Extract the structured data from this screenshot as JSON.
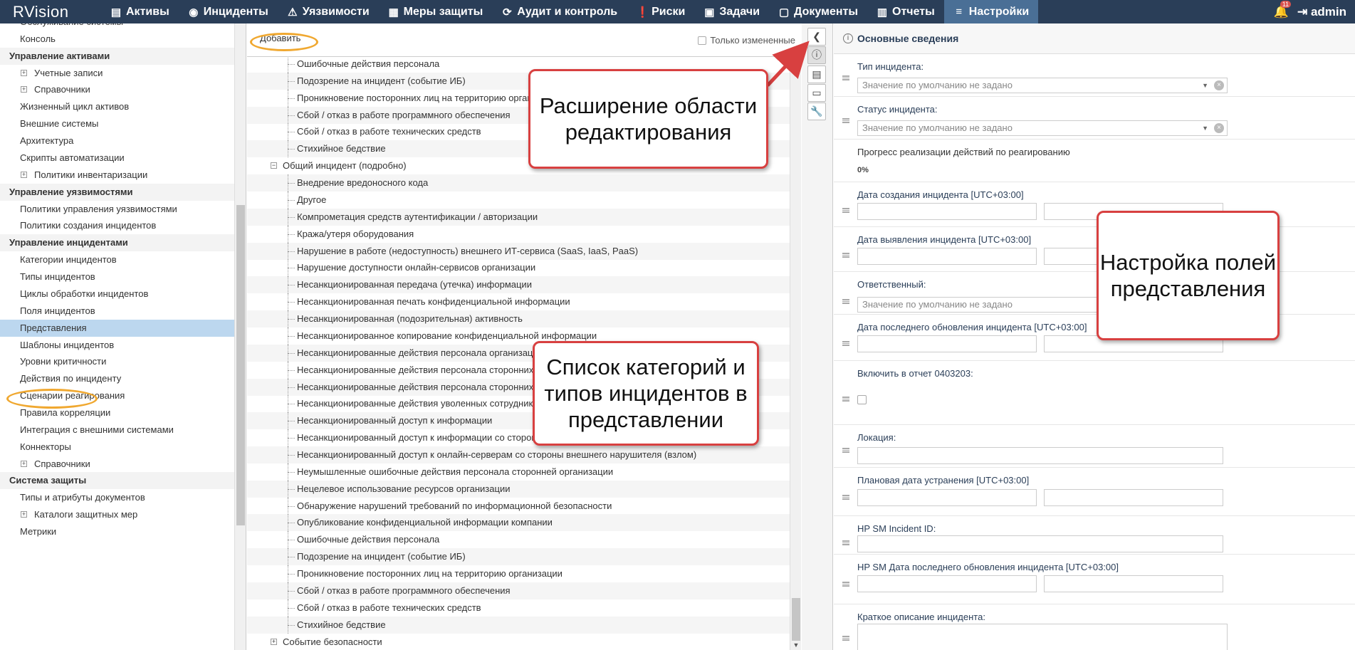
{
  "app": {
    "logo": "RVision"
  },
  "nav": [
    {
      "label": "Активы",
      "icon": "database-icon",
      "glyph": "▤"
    },
    {
      "label": "Инциденты",
      "icon": "target-icon",
      "glyph": "◉"
    },
    {
      "label": "Уязвимости",
      "icon": "warning-icon",
      "glyph": "⚠"
    },
    {
      "label": "Меры защиты",
      "icon": "shield-icon",
      "glyph": "▦"
    },
    {
      "label": "Аудит и контроль",
      "icon": "refresh-icon",
      "glyph": "⟳"
    },
    {
      "label": "Риски",
      "icon": "alert-circle-icon",
      "glyph": "❗"
    },
    {
      "label": "Задачи",
      "icon": "tasks-icon",
      "glyph": "▣"
    },
    {
      "label": "Документы",
      "icon": "document-icon",
      "glyph": "▢"
    },
    {
      "label": "Отчеты",
      "icon": "report-icon",
      "glyph": "▥"
    },
    {
      "label": "Настройки",
      "icon": "menu-icon",
      "glyph": "≡"
    }
  ],
  "top_right": {
    "notifications": "11",
    "user": "admin"
  },
  "sidebar": {
    "rows": [
      {
        "type": "item",
        "label": "Обслуживание системы"
      },
      {
        "type": "item",
        "label": "Консоль"
      },
      {
        "type": "group",
        "label": "Управление активами"
      },
      {
        "type": "sub",
        "label": "Учетные записи"
      },
      {
        "type": "sub",
        "label": "Справочники"
      },
      {
        "type": "item",
        "label": "Жизненный цикл активов"
      },
      {
        "type": "item",
        "label": "Внешние системы"
      },
      {
        "type": "item",
        "label": "Архитектура"
      },
      {
        "type": "item",
        "label": "Скрипты автоматизации"
      },
      {
        "type": "sub",
        "label": "Политики инвентаризации"
      },
      {
        "type": "group",
        "label": "Управление уязвимостями"
      },
      {
        "type": "item",
        "label": "Политики управления уязвимостями"
      },
      {
        "type": "item",
        "label": "Политики создания инцидентов"
      },
      {
        "type": "group",
        "label": "Управление инцидентами"
      },
      {
        "type": "item",
        "label": "Категории инцидентов"
      },
      {
        "type": "item",
        "label": "Типы инцидентов"
      },
      {
        "type": "item",
        "label": "Циклы обработки инцидентов"
      },
      {
        "type": "item",
        "label": "Поля инцидентов"
      },
      {
        "type": "item",
        "label": "Представления",
        "selected": true
      },
      {
        "type": "item",
        "label": "Шаблоны инцидентов"
      },
      {
        "type": "item",
        "label": "Уровни критичности"
      },
      {
        "type": "item",
        "label": "Действия по инциденту"
      },
      {
        "type": "item",
        "label": "Сценарии реагирования"
      },
      {
        "type": "item",
        "label": "Правила корреляции"
      },
      {
        "type": "item",
        "label": "Интеграция с внешними системами"
      },
      {
        "type": "item",
        "label": "Коннекторы"
      },
      {
        "type": "sub",
        "label": "Справочники"
      },
      {
        "type": "group",
        "label": "Система защиты"
      },
      {
        "type": "item",
        "label": "Типы и атрибуты документов"
      },
      {
        "type": "sub",
        "label": "Каталоги защитных мер"
      },
      {
        "type": "item",
        "label": "Метрики"
      }
    ]
  },
  "toolbar": {
    "add_label": "Добавить",
    "only_changed_label": "Только измененные"
  },
  "tree": {
    "rows": [
      {
        "level": 2,
        "label": "Ошибочные действия персонала"
      },
      {
        "level": 2,
        "label": "Подозрение на инцидент (событие ИБ)"
      },
      {
        "level": 2,
        "label": "Проникновение посторонних лиц на территорию организации"
      },
      {
        "level": 2,
        "label": "Сбой / отказ в работе программного обеспечения"
      },
      {
        "level": 2,
        "label": "Сбой / отказ в работе технических средств"
      },
      {
        "level": 2,
        "label": "Стихийное бедствие"
      },
      {
        "level": 1,
        "label": "Общий инцидент (подробно)",
        "expanded": true
      },
      {
        "level": 2,
        "label": "Внедрение вредоносного кода"
      },
      {
        "level": 2,
        "label": "Другое"
      },
      {
        "level": 2,
        "label": "Компрометация средств аутентификации / авторизации"
      },
      {
        "level": 2,
        "label": "Кража/утеря оборудования"
      },
      {
        "level": 2,
        "label": "Нарушение в работе (недоступность) внешнего ИТ-сервиса (SaaS, IaaS, PaaS)"
      },
      {
        "level": 2,
        "label": "Нарушение доступности онлайн-сервисов организации"
      },
      {
        "level": 2,
        "label": "Несанкционированная передача (утечка) информации"
      },
      {
        "level": 2,
        "label": "Несанкционированная печать конфиденциальной информации"
      },
      {
        "level": 2,
        "label": "Несанкционированная (подозрительная) активность"
      },
      {
        "level": 2,
        "label": "Несанкционированное копирование конфиденциальной информации"
      },
      {
        "level": 2,
        "label": "Несанкционированные действия персонала организации"
      },
      {
        "level": 2,
        "label": "Несанкционированные действия персонала сторонних организаций"
      },
      {
        "level": 2,
        "label": "Несанкционированные действия персонала сторонних организаций"
      },
      {
        "level": 2,
        "label": "Несанкционированные действия уволенных сотрудников"
      },
      {
        "level": 2,
        "label": "Несанкционированный доступ к информации"
      },
      {
        "level": 2,
        "label": "Несанкционированный доступ к информации со стороны внешнего нарушителя"
      },
      {
        "level": 2,
        "label": "Несанкционированный доступ к онлайн-серверам со стороны внешнего нарушителя (взлом)"
      },
      {
        "level": 2,
        "label": "Неумышленные ошибочные действия персонала сторонней организации"
      },
      {
        "level": 2,
        "label": "Нецелевое использование ресурсов организации"
      },
      {
        "level": 2,
        "label": "Обнаружение нарушений требований по информационной безопасности"
      },
      {
        "level": 2,
        "label": "Опубликование конфиденциальной информации компании"
      },
      {
        "level": 2,
        "label": "Ошибочные действия персонала"
      },
      {
        "level": 2,
        "label": "Подозрение на инцидент (событие ИБ)"
      },
      {
        "level": 2,
        "label": "Проникновение посторонних лиц на территорию организации"
      },
      {
        "level": 2,
        "label": "Сбой / отказ в работе программного обеспечения"
      },
      {
        "level": 2,
        "label": "Сбой / отказ в работе технических средств"
      },
      {
        "level": 2,
        "label": "Стихийное бедствие"
      },
      {
        "level": 1,
        "label": "Событие безопасности",
        "expanded": false
      }
    ]
  },
  "strip": [
    {
      "name": "collapse-panel-button",
      "glyph": "❮"
    },
    {
      "name": "info-tab-button",
      "glyph": "ⓘ"
    },
    {
      "name": "list-tab-button",
      "glyph": "▤"
    },
    {
      "name": "monitor-tab-button",
      "glyph": "▭"
    },
    {
      "name": "settings-tab-button",
      "glyph": "🔧"
    }
  ],
  "form": {
    "section_title": "Основные сведения",
    "default_placeholder": "Значение по умолчанию не задано",
    "fields": {
      "incident_type": "Тип инцидента:",
      "incident_status": "Статус инцидента:",
      "progress": "Прогресс реализации действий по реагированию",
      "progress_value": "0%",
      "created_date": "Дата создания инцидента [UTC+03:00]",
      "detected_date": "Дата выявления инцидента [UTC+03:00]",
      "responsible": "Ответственный:",
      "last_update": "Дата последнего обновления инцидента [UTC+03:00]",
      "include_report": "Включить в отчет 0403203:",
      "location": "Локация:",
      "planned_fix": "Плановая дата устранения [UTC+03:00]",
      "hp_id": "HP SM Incident ID:",
      "hp_last_update": "HP SM Дата последнего обновления инцидента [UTC+03:00]",
      "short_desc": "Краткое описание инцидента:"
    }
  },
  "callouts": {
    "expand": "Расширение области редактирования",
    "list": "Список категорий и типов инцидентов в представлении",
    "fields": "Настройка полей представления"
  },
  "colors": {
    "nav_bg": "#2a3e58",
    "nav_active": "#4a6f96",
    "selection": "#bcd7ef",
    "callout_border": "#d84040",
    "highlight": "#f0a830"
  }
}
